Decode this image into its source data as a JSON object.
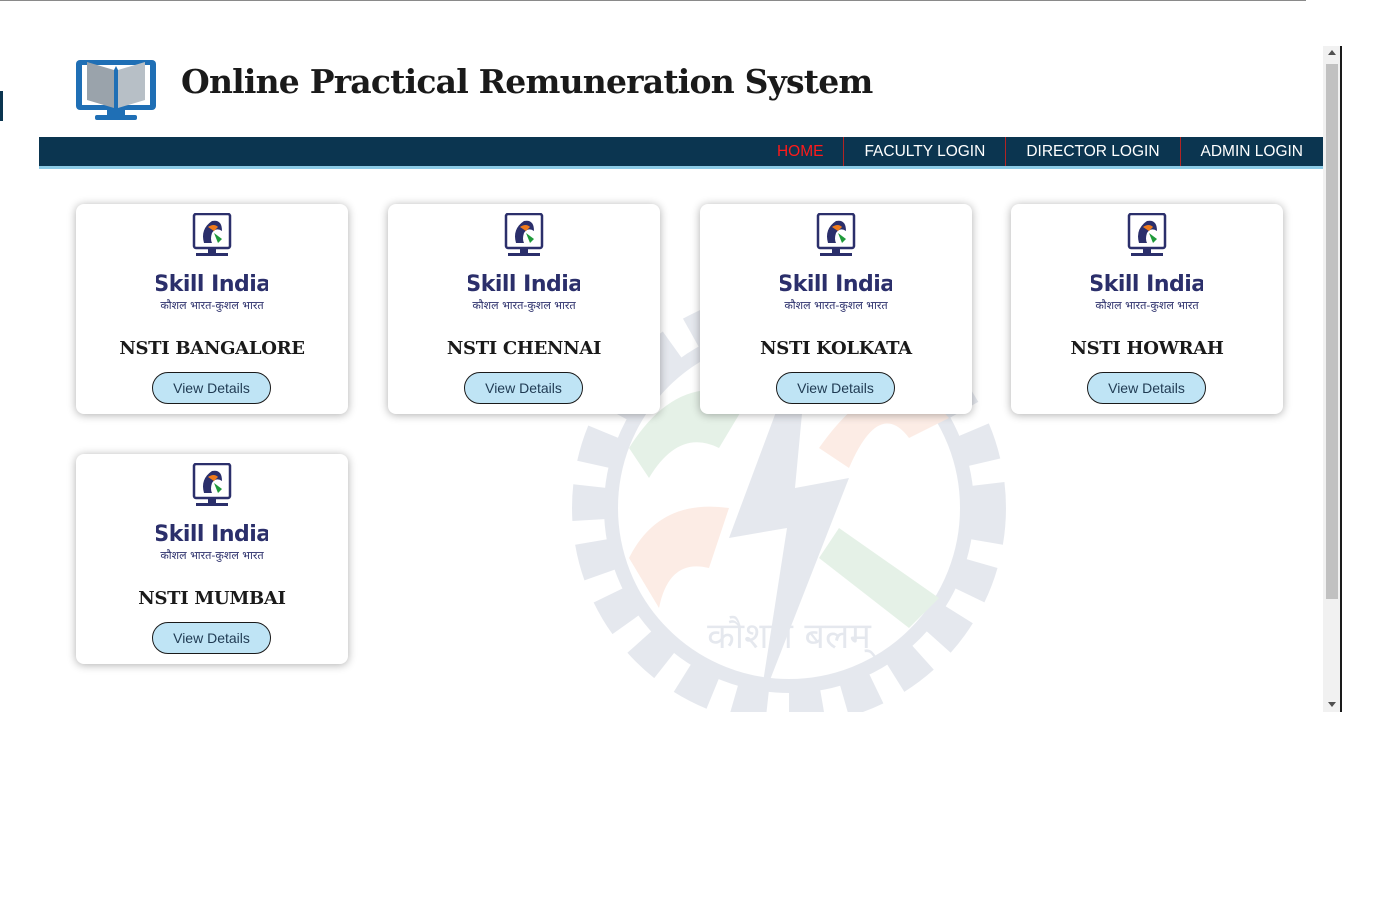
{
  "header": {
    "title": "Online Practical Remuneration System",
    "logo_icon": "book-monitor-icon"
  },
  "nav": {
    "items": [
      {
        "label": "HOME",
        "active": true
      },
      {
        "label": "FACULTY LOGIN",
        "active": false
      },
      {
        "label": "DIRECTOR LOGIN",
        "active": false
      },
      {
        "label": "ADMIN LOGIN",
        "active": false
      }
    ]
  },
  "colors": {
    "nav_bg": "#0b3550",
    "nav_underline": "#8ccbe6",
    "nav_active": "#ff1a1a",
    "nav_divider": "#b22424",
    "button_bg": "#bfe4f5"
  },
  "skill_logo": {
    "brand": "Skill India",
    "tagline": "कौशल भारत-कुशल भारत"
  },
  "watermark": {
    "text": "कौशलं बलम्"
  },
  "cards": [
    {
      "title": "NSTI BANGALORE",
      "button_label": "View Details"
    },
    {
      "title": "NSTI CHENNAI",
      "button_label": "View Details"
    },
    {
      "title": "NSTI KOLKATA",
      "button_label": "View Details"
    },
    {
      "title": "NSTI HOWRAH",
      "button_label": "View Details"
    },
    {
      "title": "NSTI MUMBAI",
      "button_label": "View Details"
    }
  ]
}
